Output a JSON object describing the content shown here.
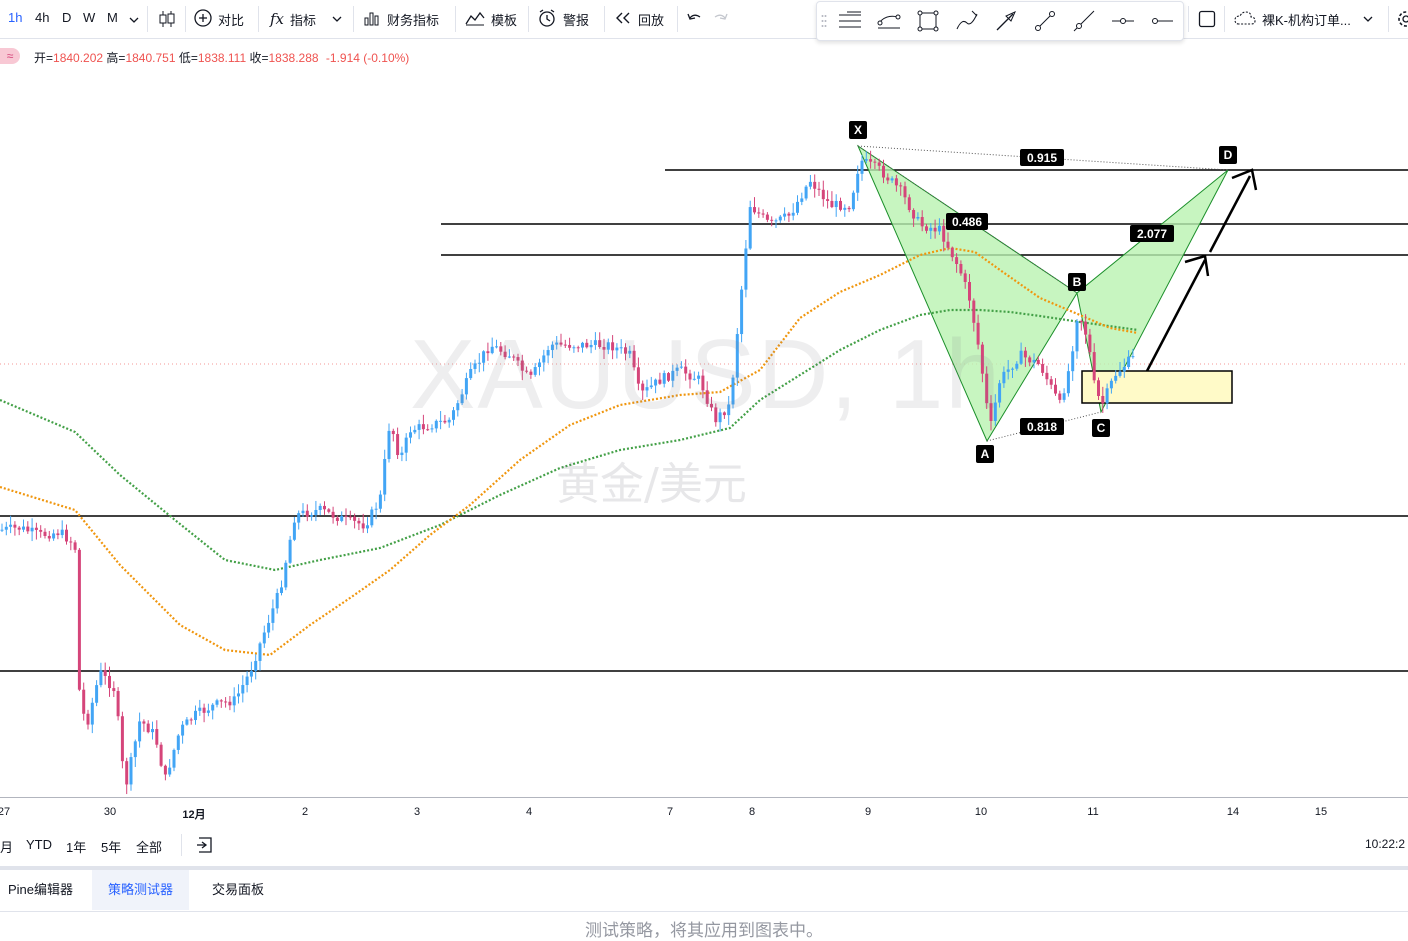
{
  "toolbar": {
    "timeframes": [
      "1h",
      "4h",
      "D",
      "W",
      "M"
    ],
    "active_timeframe": "1h",
    "compare": "对比",
    "indicators": "指标",
    "financials": "财务指标",
    "templates": "模板",
    "alert": "警报",
    "replay": "回放",
    "drawing_select": "裸K-机构订单..."
  },
  "ohlc": {
    "open_label": "开=",
    "open": "1840.202",
    "high_label": "高=",
    "high": "1840.751",
    "low_label": "低=",
    "low": "1838.111",
    "close_label": "收=",
    "close": "1838.288",
    "change": "-1.914 (-0.10%)"
  },
  "watermark": {
    "symbol": "XAUUSD, 1h",
    "description": "黄金/美元"
  },
  "pattern": {
    "points": [
      "X",
      "A",
      "B",
      "C",
      "D"
    ],
    "ratios": {
      "xb": "0.486",
      "ac": "0.818",
      "bd": "2.077",
      "xd": "0.915"
    }
  },
  "time_axis": {
    "labels": [
      "27",
      "30",
      "12月",
      "2",
      "3",
      "4",
      "7",
      "8",
      "9",
      "10",
      "11",
      "14",
      "15"
    ],
    "clock": "10:22:2"
  },
  "range_bar": {
    "items": [
      "月",
      "YTD",
      "1年",
      "5年",
      "全部"
    ]
  },
  "bottom_tabs": {
    "tabs": [
      "Pine编辑器",
      "策略测试器",
      "交易面板"
    ],
    "active": "策略测试器"
  },
  "panel_message": "测试策略，将其应用到图表中。",
  "colors": {
    "up": "#42a5f5",
    "down": "#d5457a",
    "ma_fast": "#f0960e",
    "ma_slow": "#43a047",
    "pattern_fill": "#b9f2b0",
    "accent": "#2962ff"
  }
}
